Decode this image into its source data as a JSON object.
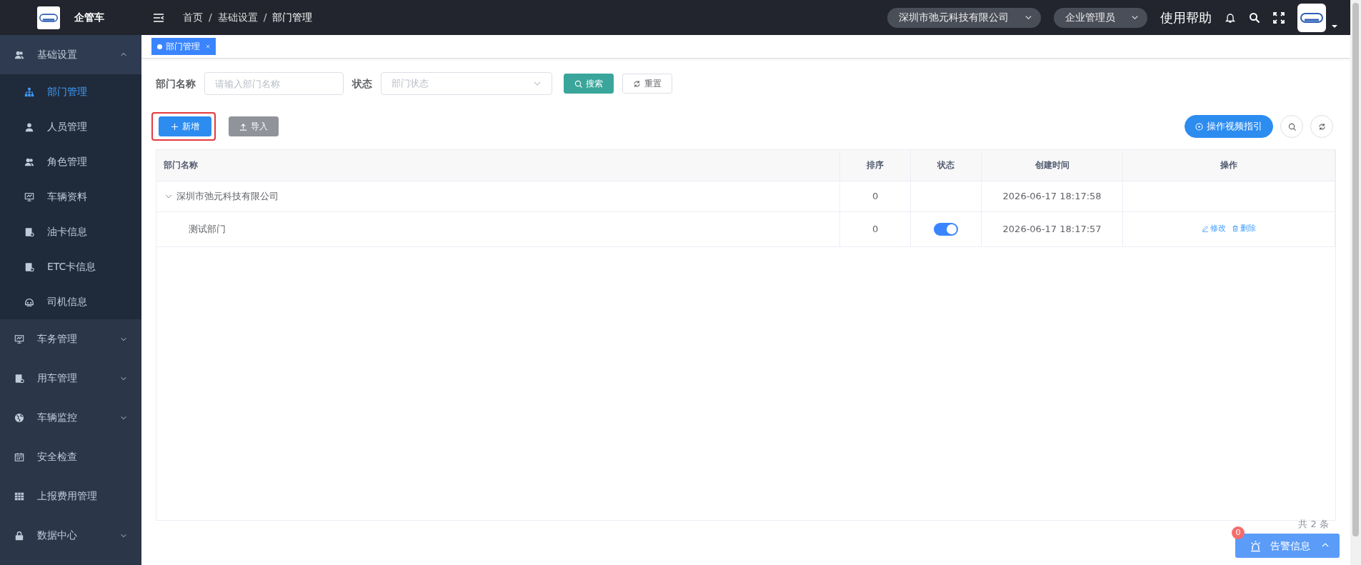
{
  "sidebar": {
    "brand": "企管车",
    "menu": [
      {
        "label": "基础设置",
        "expanded": true,
        "children": [
          {
            "label": "部门管理",
            "selected": true
          },
          {
            "label": "人员管理",
            "selected": false
          },
          {
            "label": "角色管理",
            "selected": false
          },
          {
            "label": "车辆资料",
            "selected": false
          },
          {
            "label": "油卡信息",
            "selected": false
          },
          {
            "label": "ETC卡信息",
            "selected": false
          },
          {
            "label": "司机信息",
            "selected": false
          }
        ]
      },
      {
        "label": "车务管理",
        "expanded": false
      },
      {
        "label": "用车管理",
        "expanded": false
      },
      {
        "label": "车辆监控",
        "expanded": false
      },
      {
        "label": "安全检查"
      },
      {
        "label": "上报费用管理"
      },
      {
        "label": "数据中心",
        "expanded": false
      }
    ]
  },
  "header": {
    "breadcrumb": [
      {
        "kind": "link",
        "text": "首页"
      },
      {
        "kind": "separator",
        "text": "/"
      },
      {
        "kind": "link",
        "text": "基础设置"
      },
      {
        "kind": "separator",
        "text": "/"
      },
      {
        "kind": "current",
        "text": "部门管理"
      }
    ],
    "company_select": "深圳市弛元科技有限公司",
    "role_select": "企业管理员",
    "help": "使用帮助"
  },
  "tabs": [
    {
      "label": "部门管理",
      "selected": true
    }
  ],
  "filter": {
    "fields": [
      {
        "label": "部门名称",
        "placeholder": "请输入部门名称",
        "kind": "input"
      },
      {
        "label": "状态",
        "placeholder": "部门状态",
        "kind": "select"
      }
    ],
    "search_button": "搜索",
    "reset_button": "重置"
  },
  "toolbar": {
    "add_button": {
      "label": "新增",
      "highlighted": true
    },
    "import_button": "导入",
    "video_button": "操作视频指引"
  },
  "table": {
    "columns": [
      "部门名称",
      "排序",
      "状态",
      "创建时间",
      "操作"
    ],
    "rows": [
      {
        "name": "深圳市弛元科技有限公司",
        "sort": "0",
        "created": "2026-06-17 18:17:58",
        "expanded": true,
        "children": [
          {
            "name": "测试部门",
            "sort": "0",
            "on": true,
            "created": "2026-06-17 18:17:57",
            "actions": [
              "修改",
              "删除"
            ]
          }
        ]
      }
    ]
  },
  "pagination": {
    "total": "共 2 条"
  },
  "alarm": {
    "count": "0",
    "label": "告警信息",
    "expanded": false
  }
}
